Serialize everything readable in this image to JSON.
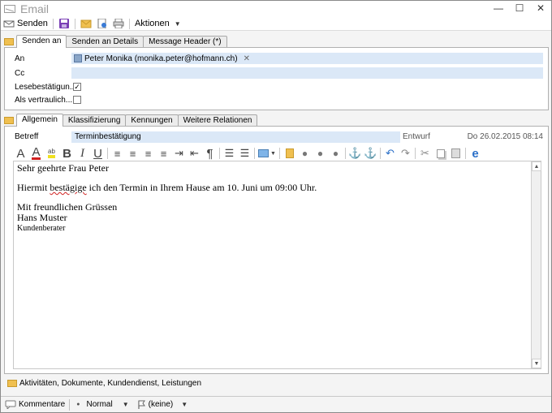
{
  "window": {
    "title": "Email"
  },
  "toolbar": {
    "send_label": "Senden",
    "actions_label": "Aktionen"
  },
  "recipient_tabs": [
    "Senden an",
    "Senden an Details",
    "Message Header (*)"
  ],
  "recipients": {
    "to_label": "An",
    "to_value": "Peter Monika (monika.peter@hofmann.ch)",
    "cc_label": "Cc",
    "cc_value": "",
    "read_receipt_label": "Lesebestätigun...",
    "read_receipt_checked": true,
    "confidential_label": "Als  vertraulich...",
    "confidential_checked": false
  },
  "main_tabs": [
    "Allgemein",
    "Klassifizierung",
    "Kennungen",
    "Weitere Relationen"
  ],
  "subject": {
    "label": "Betreff",
    "value": "Terminbestätigung",
    "status": "Entwurf",
    "date": "Do 26.02.2015 08:14"
  },
  "editor": {
    "greeting": "Sehr geehrte Frau Peter",
    "body_before": "Hiermit ",
    "body_misspelled": "bestägige",
    "body_after": " ich den Termin in Ihrem Hause am 10. Juni um 09:00 Uhr.",
    "closing": "Mit freundlichen Grüssen",
    "name": "Hans Muster",
    "role": "Kundenberater"
  },
  "footer": {
    "activities_label": "Aktivitäten, Dokumente, Kundendienst, Leistungen",
    "comments_label": "Kommentare",
    "priority_value": "Normal",
    "flag_value": "(keine)"
  },
  "colors": {
    "field_bg": "#dbe8f7",
    "accent_blue": "#2a6fc8",
    "folder": "#f0c050"
  }
}
